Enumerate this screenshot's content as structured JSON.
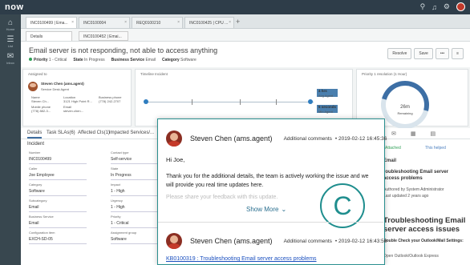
{
  "app": {
    "logo": "now",
    "icons": [
      "search-icon",
      "bell-icon",
      "gear-icon"
    ]
  },
  "nav": {
    "items": [
      {
        "label": "Home",
        "icon": "home-icon"
      },
      {
        "label": "List",
        "icon": "list-icon"
      },
      {
        "label": "Inbox",
        "icon": "chat-icon"
      }
    ]
  },
  "window_tabs": [
    "INC0100499 | Ema...",
    "INC0100004",
    "REQ0100210",
    "INC0100425 | CPU ..."
  ],
  "sub_tabs": [
    "Details",
    "INC0100452 | Emai..."
  ],
  "record": {
    "title": "Email server is not responding, not able to access anything",
    "priority_label": "Priority",
    "priority": "1 - Critical",
    "state_label": "State",
    "state": "In Progress",
    "service_label": "Business Service",
    "service": "Email",
    "category_label": "Category",
    "category": "Software",
    "buttons": [
      "Resolve",
      "Save"
    ]
  },
  "assigned": {
    "label": "Assigned to",
    "name": "Steven Chen (ams.agent)",
    "role": "Service Desk Agent",
    "name_label": "Name",
    "name_value": "Steven Ch...",
    "location_label": "Location",
    "location_value": "3121 High Point R...",
    "phone_label": "Business phone",
    "phone_value": "(778) 242-2707",
    "mobile_label": "Mobile phone",
    "mobile_value": "(778) 882-3...",
    "email_label": "Email",
    "email_value": "steven.chen..."
  },
  "timeline": {
    "label": "Timeline Incident",
    "items": [
      {
        "value": "4 hrs",
        "sub": "Avg Agent"
      },
      {
        "value": "5 seconds",
        "sub": "Min Agent"
      }
    ]
  },
  "sla": {
    "label": "Priority 1 resolution (1 Hour)",
    "value": "26m",
    "sub": "Remaining"
  },
  "form_tabs": [
    "Details",
    "Task SLAs(6)",
    "Affected CIs(1)",
    "Impacted Services/..."
  ],
  "form": {
    "header": "Incident",
    "fields": [
      {
        "label": "Number",
        "value": "INC0100499"
      },
      {
        "label": "Contact type",
        "value": "Self-service"
      },
      {
        "label": "Caller",
        "value": "Joe Employee"
      },
      {
        "label": "State",
        "value": "In Progress"
      },
      {
        "label": "Category",
        "value": "Software"
      },
      {
        "label": "Impact",
        "value": "1 - High"
      },
      {
        "label": "Subcategory",
        "value": "Email"
      },
      {
        "label": "Urgency",
        "value": "1 - High"
      },
      {
        "label": "Business Service",
        "value": "Email"
      },
      {
        "label": "Priority",
        "value": "1 - Critical"
      },
      {
        "label": "Configuration item",
        "value": "EXCH-SD-05"
      },
      {
        "label": "Assignment group",
        "value": "Software"
      }
    ]
  },
  "kb_side": {
    "attached": "Attached",
    "helped": "This helped",
    "title1": "Email",
    "title2": "roubleshooting Email server",
    "title3": "access problems",
    "author": "Authored by System Administrator",
    "updated": "Last updated 2 years ago",
    "big": "Troubleshooting Email server access issues",
    "step": "Double Check your Outlook/Mail Settings:",
    "sub": "Open Outlook/Outlook Express"
  },
  "comments": [
    {
      "author": "Steven Chen (ams.agent)",
      "type": "Additional comments",
      "date": "2019-02-12 16:45:36",
      "greeting": "Hi Joe,",
      "body": "Thank you for the additional details, the team is actively working the issue and we will provide you real time updates here.",
      "faded": "Please share your feedback with this update."
    },
    {
      "author": "Steven Chen (ams.agent)",
      "type": "Additional comments",
      "date": "2019-02-12 16:43:56",
      "link": "KB0100319 : Troubleshooting Email server access problems"
    }
  ],
  "show_more": "Show More",
  "badge": "C",
  "colors": {
    "accent": "#1f8e8e",
    "link": "#1a4fbf",
    "topbar": "#2e3d49"
  }
}
